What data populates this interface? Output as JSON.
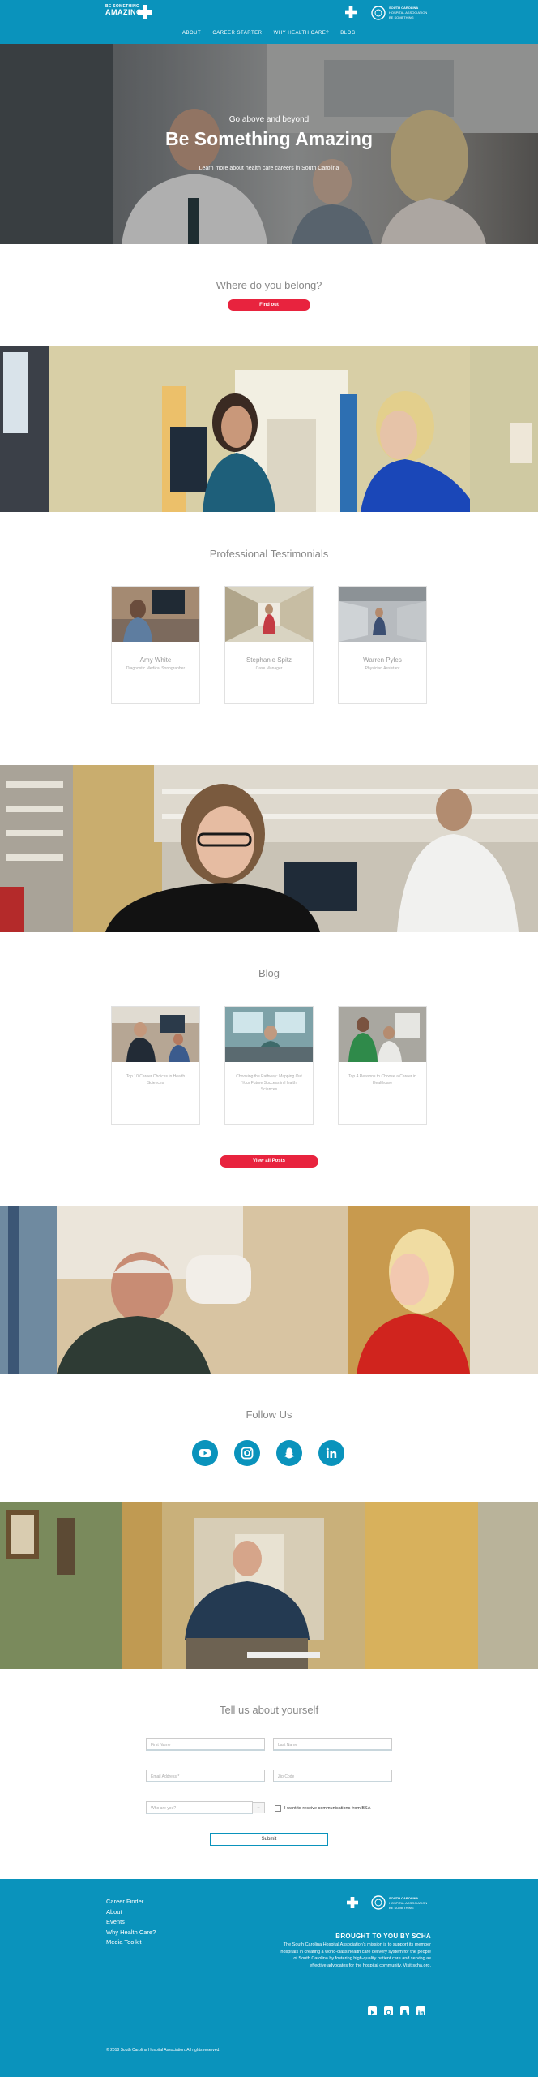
{
  "header": {
    "logo_line1": "BE SOMETHING",
    "logo_line2": "AMAZING",
    "partner_line1": "SOUTH CAROLINA",
    "partner_line2": "HOSPITAL ASSOCIATION",
    "partner_line3": "BE SOMETHING",
    "nav": [
      "ABOUT",
      "CAREER STARTER",
      "WHY HEALTH CARE?",
      "BLOG"
    ]
  },
  "hero": {
    "pretitle": "Go above and beyond",
    "title": "Be Something Amazing",
    "subtitle": "Learn more about health care careers in South Carolina"
  },
  "belong": {
    "title": "Where do you belong?",
    "button": "Find out"
  },
  "testimonials": {
    "title": "Professional Testimonials",
    "items": [
      {
        "name": "Amy White",
        "role": "Diagnostic Medical Sonographer"
      },
      {
        "name": "Stephanie Spitz",
        "role": "Case Manager"
      },
      {
        "name": "Warren Pyles",
        "role": "Physician Assistant"
      }
    ]
  },
  "blog": {
    "title": "Blog",
    "items": [
      {
        "text": "Top 10 Career Choices in Health Sciences"
      },
      {
        "text": "Choosing the Pathway: Mapping Out Your Future Success in Health Sciences"
      },
      {
        "text": "Top 4 Reasons to Choose a Career in Healthcare"
      }
    ],
    "button": "View all Posts"
  },
  "follow": {
    "title": "Follow Us",
    "icons": [
      "youtube-icon",
      "instagram-icon",
      "snapchat-icon",
      "linkedin-icon"
    ]
  },
  "form": {
    "title": "Tell us about yourself",
    "first_name": "First Name",
    "last_name": "Last Name",
    "email": "Email Address *",
    "zip": "Zip Code",
    "who": "Who are you?",
    "consent": "I want to receive communications from BSA",
    "submit": "Submit"
  },
  "footer": {
    "links": [
      "Career Finder",
      "About",
      "Events",
      "Why Health Care?",
      "Media Toolkit"
    ],
    "brought": "BROUGHT TO YOU BY SCHA",
    "mission": "The South Carolina Hospital Association's mission is to support its member hospitals in creating a world-class health care delivery system for the people of South Carolina by fostering high-quality patient care and serving as effective advocates for the hospital community. Visit scha.org.",
    "copyright": "© 2018 South Carolina Hospital Association. All rights reserved."
  },
  "colors": {
    "brand_blue": "#0a93bc",
    "accent_red": "#e8233e"
  }
}
